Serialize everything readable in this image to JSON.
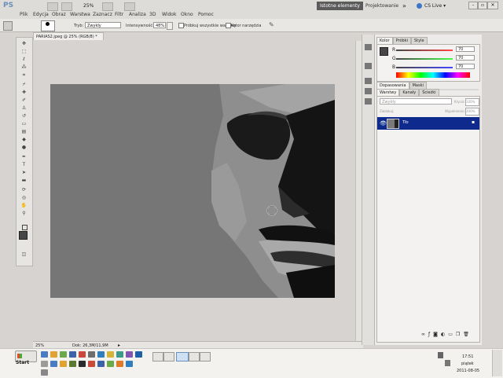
{
  "app": {
    "logo": "PS",
    "zoom_display": "25%"
  },
  "menu": [
    "Plik",
    "Edycja",
    "Obraz",
    "Warstwa",
    "Zaznacz",
    "Filtr",
    "Analiza",
    "3D",
    "Widok",
    "Okno",
    "Pomoc"
  ],
  "workspace": {
    "active": "Istotne elementy",
    "other": "Projektowanie",
    "overflow": "»",
    "cs_live": "CS Live ▾"
  },
  "options": {
    "mode_label": "Tryb:",
    "mode_value": "Zwykły",
    "intensity_label": "Intensywność:",
    "intensity_value": "48%",
    "sample_all_label": "Próbkuj wszystkie warstwy",
    "color_label": "Kolor narzędzia"
  },
  "document": {
    "tab_title": "PARIAS2.jpeg @ 25% (RGB/8) *"
  },
  "status": {
    "zoom": "25%",
    "doc_info": "Dok: 26,3M/11,9M"
  },
  "color_panel": {
    "tabs": [
      "Kolor",
      "Próbki",
      "Style"
    ],
    "r_label": "R",
    "r_value": "70",
    "g_label": "G",
    "g_value": "70",
    "b_label": "B",
    "b_value": "70"
  },
  "adjust_panel": {
    "tabs": [
      "Dopasowania",
      "Maski"
    ]
  },
  "layers_panel": {
    "tabs": [
      "Warstwy",
      "Kanały",
      "Ścieżki"
    ],
    "blend_mode": "Zwykły",
    "opacity_label": "Krycie:",
    "opacity_value": "100%",
    "lock_label": "Zablokuj:",
    "fill_label": "Wypełnienie:",
    "fill_value": "100%",
    "layer_name": "Tło",
    "layer_color": "#0d2a8c"
  },
  "taskbar": {
    "start_label": "Start",
    "time": "17:51",
    "day": "piątek",
    "date": "2011-08-05"
  }
}
